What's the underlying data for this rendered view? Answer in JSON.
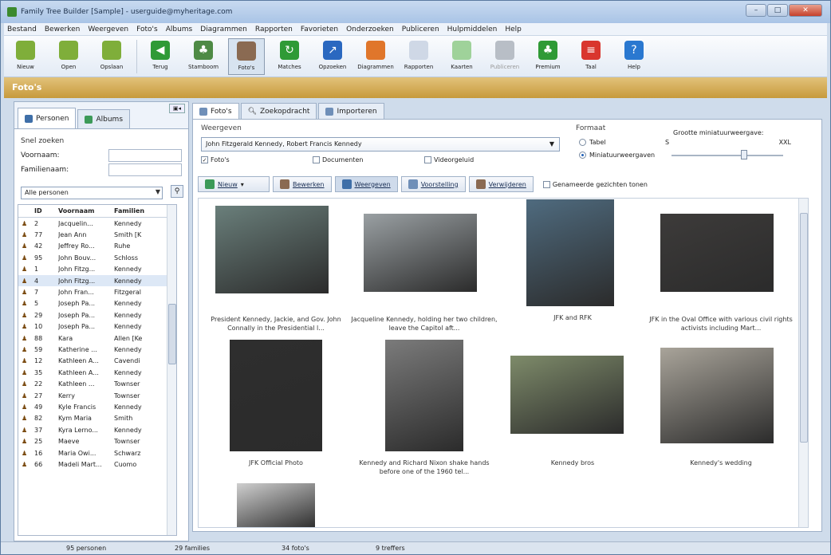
{
  "window": {
    "title": "Family Tree Builder [Sample] - userguide@myheritage.com",
    "controls": [
      "–",
      "□",
      "✕"
    ]
  },
  "menu": [
    "Bestand",
    "Bewerken",
    "Weergeven",
    "Foto's",
    "Albums",
    "Diagrammen",
    "Rapporten",
    "Favorieten",
    "Onderzoeken",
    "Publiceren",
    "Hulpmiddelen",
    "Help"
  ],
  "toolbar": [
    {
      "label": "Nieuw",
      "icon": "new-icon",
      "color": "#7fae3a"
    },
    {
      "label": "Open",
      "icon": "open-icon",
      "color": "#7fae3a"
    },
    {
      "label": "Opslaan",
      "icon": "save-icon",
      "color": "#7fae3a"
    },
    {
      "label": "Terug",
      "icon": "back-icon",
      "color": "#2f9a36"
    },
    {
      "label": "Stamboom",
      "icon": "tree-icon",
      "color": "#4e8a45"
    },
    {
      "label": "Foto's",
      "icon": "photos-icon",
      "color": "#8a6a52",
      "active": true
    },
    {
      "label": "Matches",
      "icon": "matches-icon",
      "color": "#2f9a36"
    },
    {
      "label": "Opzoeken",
      "icon": "lookup-icon",
      "color": "#2a68c0"
    },
    {
      "label": "Diagrammen",
      "icon": "charts-icon",
      "color": "#e0762b"
    },
    {
      "label": "Rapporten",
      "icon": "reports-icon",
      "color": "#cfd8e6"
    },
    {
      "label": "Kaarten",
      "icon": "maps-icon",
      "color": "#9fd29a"
    },
    {
      "label": "Publiceren",
      "icon": "publish-icon",
      "color": "#b8bec6",
      "disabled": true
    },
    {
      "label": "Premium",
      "icon": "premium-icon",
      "color": "#2f9a36"
    },
    {
      "label": "Taal",
      "icon": "language-icon",
      "color": "#d9362e"
    },
    {
      "label": "Help",
      "icon": "help-icon",
      "color": "#2a78d0"
    }
  ],
  "section_title": "Foto's",
  "left": {
    "tabs": [
      "Personen",
      "Albums"
    ],
    "quick_search_title": "Snel zoeken",
    "first_name_label": "Voornaam:",
    "last_name_label": "Familienaam:",
    "filter_value": "Alle personen",
    "columns": [
      "ID",
      "Voornaam",
      "Familien"
    ],
    "rows": [
      {
        "id": "2",
        "first": "Jacquelin...",
        "last": "Kennedy"
      },
      {
        "id": "77",
        "first": "Jean Ann",
        "last": "Smith [K"
      },
      {
        "id": "42",
        "first": "Jeffrey Ro...",
        "last": "Ruhe"
      },
      {
        "id": "95",
        "first": "John Bouv...",
        "last": "Schloss"
      },
      {
        "id": "1",
        "first": "John Fitzg...",
        "last": "Kennedy"
      },
      {
        "id": "4",
        "first": "John Fitzg...",
        "last": "Kennedy"
      },
      {
        "id": "7",
        "first": "John Fran...",
        "last": "Fitzgeral"
      },
      {
        "id": "5",
        "first": "Joseph Pa...",
        "last": "Kennedy"
      },
      {
        "id": "29",
        "first": "Joseph Pa...",
        "last": "Kennedy"
      },
      {
        "id": "10",
        "first": "Joseph Pa...",
        "last": "Kennedy"
      },
      {
        "id": "88",
        "first": "Kara",
        "last": "Allen [Ke"
      },
      {
        "id": "59",
        "first": "Katherine ...",
        "last": "Kennedy"
      },
      {
        "id": "12",
        "first": "Kathleen A...",
        "last": "Cavendi"
      },
      {
        "id": "35",
        "first": "Kathleen A...",
        "last": "Kennedy"
      },
      {
        "id": "22",
        "first": "Kathleen ...",
        "last": "Townser"
      },
      {
        "id": "27",
        "first": "Kerry",
        "last": "Townser"
      },
      {
        "id": "49",
        "first": "Kyle Francis",
        "last": "Kennedy"
      },
      {
        "id": "82",
        "first": "Kym Maria",
        "last": "Smith"
      },
      {
        "id": "37",
        "first": "Kyra Lerno...",
        "last": "Kennedy"
      },
      {
        "id": "25",
        "first": "Maeve",
        "last": "Townser"
      },
      {
        "id": "16",
        "first": "Maria Owi...",
        "last": "Schwarz"
      },
      {
        "id": "66",
        "first": "Madeli Mart...",
        "last": "Cuomo"
      }
    ],
    "selected_index": 5
  },
  "main": {
    "tabs": [
      "Foto's",
      "Zoekopdracht",
      "Importeren"
    ],
    "show_label": "Weergeven",
    "show_value": "John Fitzgerald Kennedy, Robert Francis Kennedy",
    "checks": [
      {
        "label": "Foto's",
        "checked": true
      },
      {
        "label": "Documenten",
        "checked": false
      },
      {
        "label": "Videorgeluid",
        "checked": false
      }
    ],
    "format_label": "Formaat",
    "format_options": [
      {
        "label": "Tabel",
        "on": false
      },
      {
        "label": "Miniatuurweergaven",
        "on": true
      }
    ],
    "thumb_size_label": "Grootte miniatuurweergave:",
    "thumb_size_min": "S",
    "thumb_size_max": "XXL",
    "thumb_size_level": 0.65,
    "actions": [
      "Nieuw",
      "Bewerken",
      "Weergeven",
      "Voorstelling",
      "Verwijderen"
    ],
    "hidden_faces_label": "Genameerde gezichten tonen",
    "photos": [
      {
        "caption": "President Kennedy, Jackie, and Gov. John Connally in the Presidential l..."
      },
      {
        "caption": "Jacqueline Kennedy, holding her two children, leave the Capitol aft..."
      },
      {
        "caption": "JFK and RFK"
      },
      {
        "caption": "JFK in the Oval Office with various civil rights activists including Mart..."
      },
      {
        "caption": "JFK Official Photo"
      },
      {
        "caption": "Kennedy and Richard Nixon shake hands before one of the 1960 tel..."
      },
      {
        "caption": "Kennedy bros"
      },
      {
        "caption": "Kennedy's wedding"
      },
      {
        "caption": ""
      }
    ]
  },
  "status": {
    "persons": "95 personen",
    "families": "29 families",
    "photos": "34 foto's",
    "hits": "9 treffers"
  }
}
